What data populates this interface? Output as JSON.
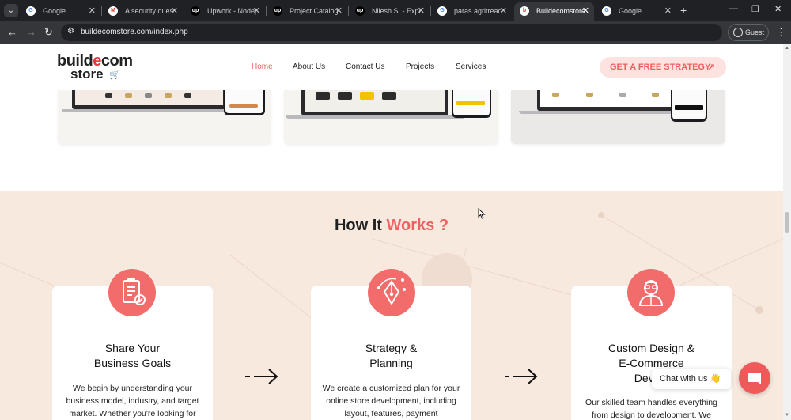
{
  "browser": {
    "tabs": [
      {
        "title": "Google",
        "favicon": "google-icon"
      },
      {
        "title": "A security question",
        "favicon": "gmail-icon"
      },
      {
        "title": "Upwork - Nodejs",
        "favicon": "upwork-icon"
      },
      {
        "title": "Project Catalog",
        "favicon": "upwork-icon"
      },
      {
        "title": "Nilesh S. - Expert",
        "favicon": "upwork-icon"
      },
      {
        "title": "paras agritread",
        "favicon": "google-icon"
      },
      {
        "title": "Buildecomstore",
        "favicon": "buildecom-icon",
        "active": true
      },
      {
        "title": "Google",
        "favicon": "google-icon"
      }
    ],
    "url": "buildecomstore.com/index.php",
    "profile_label": "Guest"
  },
  "site": {
    "logo": {
      "line1_a": "build",
      "line1_b": "e",
      "line1_c": "com",
      "line2": "store"
    },
    "nav": [
      "Home",
      "About Us",
      "Contact Us",
      "Projects",
      "Services"
    ],
    "active_nav": "Home",
    "cta_label": "GET A FREE STRATEGY",
    "cta_arrow": "↗",
    "how_title_a": "How It ",
    "how_title_b": "Works ?",
    "steps": [
      {
        "title": "Share Your\nBusiness Goals",
        "desc": "We begin by understanding your business model, industry, and target market. Whether you're looking for",
        "icon": "clipboard-checklist-icon"
      },
      {
        "title": "Strategy &\nPlanning",
        "desc": "We create a customized plan for your online store development, including layout, features, payment",
        "icon": "pen-tool-icon"
      },
      {
        "title": "Custom Design &\nE-Commerce\nDevelo",
        "desc": "Our skilled team handles everything from design to development. We",
        "icon": "developer-avatar-icon"
      }
    ],
    "chat_label": "Chat with us",
    "chat_emoji": "👋"
  },
  "colors": {
    "accent": "#ee5e5e",
    "section_bg": "#f8e9df",
    "cta_bg": "#fde3e0"
  }
}
